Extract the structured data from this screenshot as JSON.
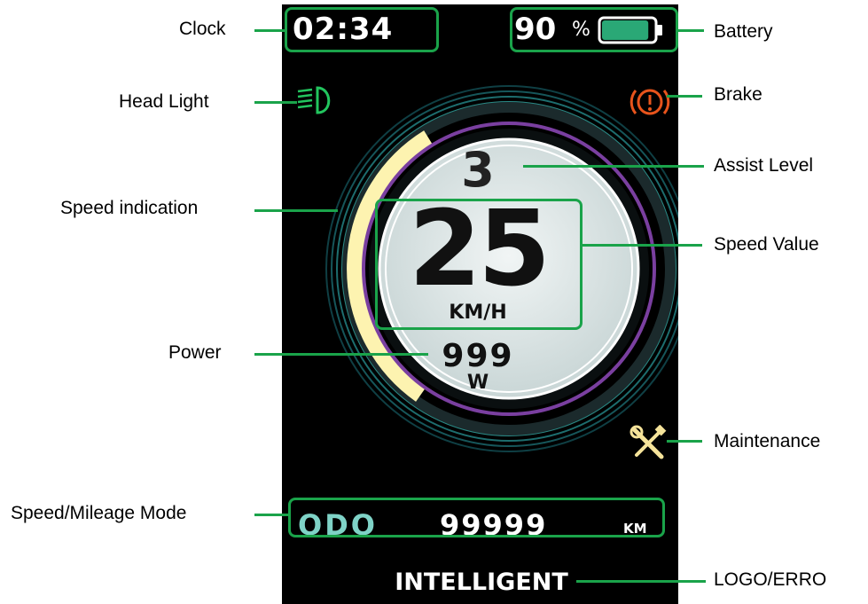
{
  "display": {
    "clock": "02:34",
    "battery_percent_text": "90",
    "battery_percent_sign": "%",
    "battery_level": 0.9,
    "assist_level": "3",
    "speed_value": "25",
    "speed_unit": "KM/H",
    "power_value": "999",
    "power_unit": "W",
    "mode_label": "ODO",
    "mileage_value": "99999",
    "mileage_unit": "KM",
    "logo_text": "INTELLIGENT",
    "speed_fraction": 0.42
  },
  "callouts": {
    "clock": "Clock",
    "battery": "Battery",
    "head_light": "Head Light",
    "brake": "Brake",
    "speed_indication": "Speed indication",
    "assist_level": "Assist Level",
    "speed_value": "Speed Value",
    "power": "Power",
    "maintenance": "Maintenance",
    "speed_mileage_mode": "Speed/Mileage Mode",
    "logo_erro": "LOGO/ERRO"
  },
  "icons": {
    "head_light": "headlight-icon",
    "brake": "brake-warning-icon",
    "maintenance": "wrench-screwdriver-icon",
    "battery": "battery-icon"
  },
  "colors": {
    "callout_green": "#1aa34a",
    "headlight_green": "#22c55e",
    "brake_orange": "#e8541c",
    "maintenance_yellow": "#f5e39a",
    "battery_fill": "#2aa876",
    "odo_teal": "#7fd3c7",
    "speed_arc": "#fdf3b0",
    "ring_purple": "#7a3fa0",
    "dial_face": "#e6ecec"
  }
}
